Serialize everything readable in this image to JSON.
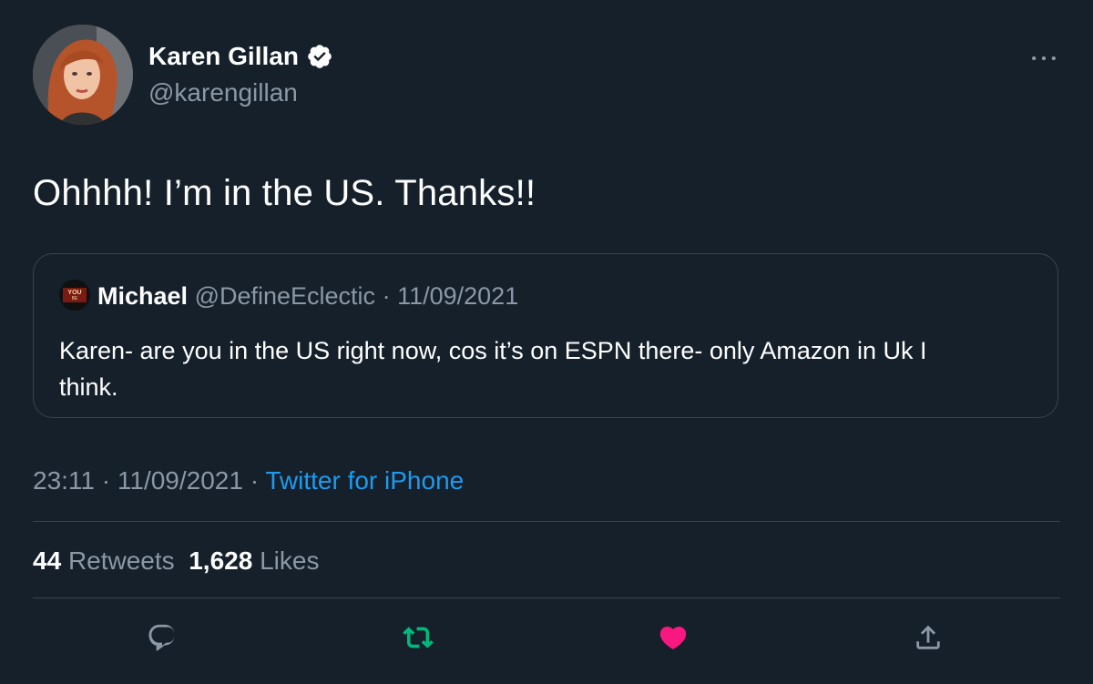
{
  "author": {
    "display_name": "Karen Gillan",
    "handle": "@karengillan",
    "verified": true,
    "avatar_icon": "profile-photo"
  },
  "tweet": {
    "text": "Ohhhh! I’m in the US. Thanks!!",
    "time": "23:11",
    "date": "11/09/2021",
    "source": "Twitter for iPhone",
    "separator": "·"
  },
  "quote": {
    "display_name": "Michael",
    "handle": "@DefineEclectic",
    "separator": "·",
    "date": "11/09/2021",
    "text_line1": "Karen- are you in the US right now, cos it’s on ESPN there- only Amazon in Uk I",
    "text_line2": "think.",
    "avatar_text_top": "YOU",
    "avatar_text_mid": "BE",
    "avatar_text_bot": "FOOL"
  },
  "stats": {
    "retweets_count": "44",
    "retweets_label": "Retweets",
    "likes_count": "1,628",
    "likes_label": "Likes"
  },
  "actions": {
    "reply_icon": "reply-icon",
    "retweet_icon": "retweet-icon",
    "like_icon": "heart-icon",
    "share_icon": "share-icon",
    "retweet_active": true,
    "liked": true
  },
  "colors": {
    "background": "#15202b",
    "text_primary": "#ffffff",
    "text_secondary": "#8b98a5",
    "link": "#1d9bf0",
    "border": "#38444d",
    "retweet_green": "#00ba7c",
    "like_pink": "#f91880"
  }
}
